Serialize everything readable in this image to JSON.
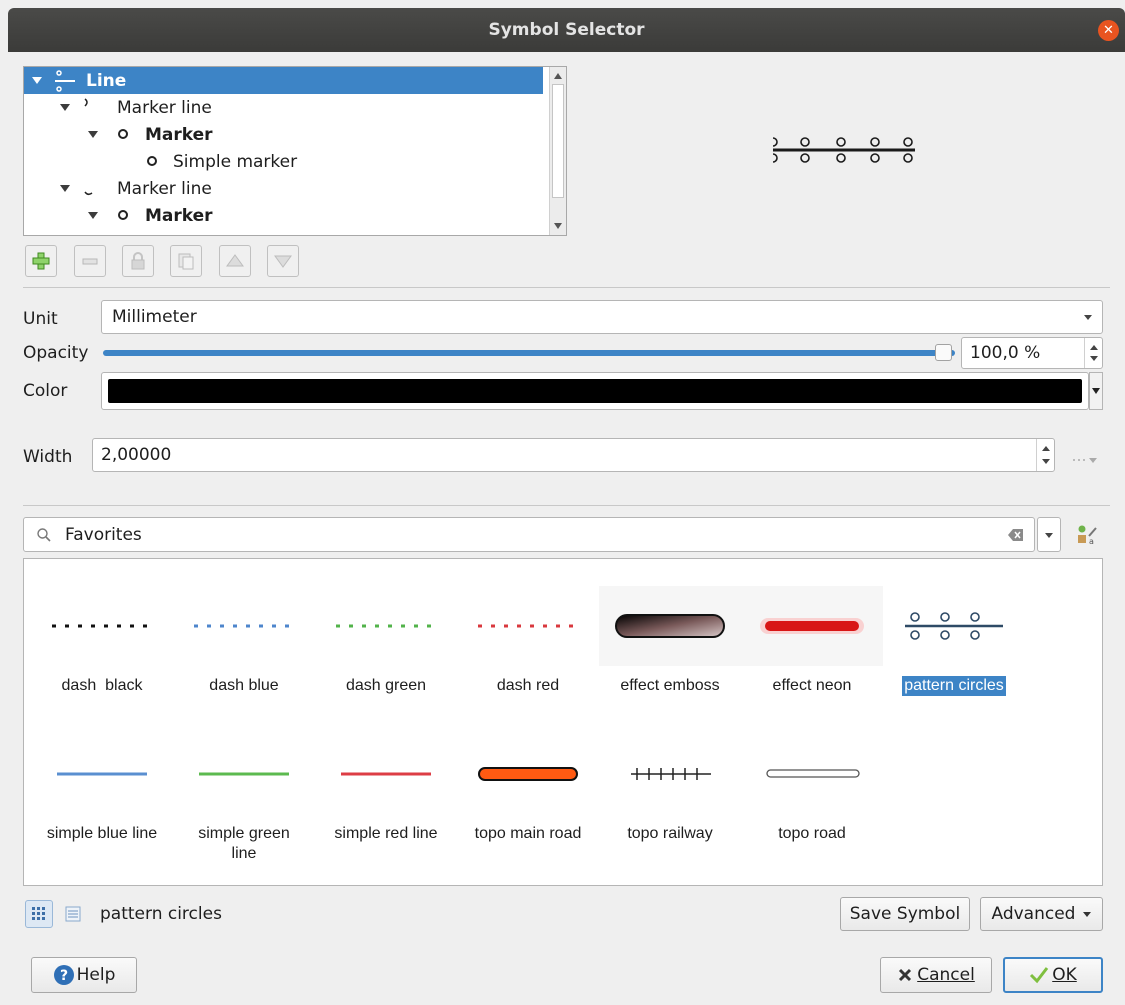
{
  "window": {
    "title": "Symbol Selector",
    "close_glyph": "✕"
  },
  "tree": {
    "rows": [
      {
        "label": "Line",
        "bold": true,
        "selected": true,
        "icon": "line-icon"
      },
      {
        "label": "Marker line",
        "bold": false,
        "icon": "marker-line-icon"
      },
      {
        "label": "Marker",
        "bold": true,
        "icon": "circle-icon"
      },
      {
        "label": "Simple marker",
        "bold": false,
        "icon": "circle-icon"
      },
      {
        "label": "Marker line",
        "bold": false,
        "icon": "marker-line-icon"
      },
      {
        "label": "Marker",
        "bold": true,
        "icon": "circle-icon"
      }
    ]
  },
  "toolbar": {
    "buttons": [
      "add-layer-icon",
      "remove-layer-icon",
      "lock-icon",
      "duplicate-icon",
      "move-up-icon",
      "move-down-icon"
    ]
  },
  "props": {
    "unit_label": "Unit",
    "unit_value": "Millimeter",
    "opacity_label": "Opacity",
    "opacity_value": "100,0 %",
    "opacity_fraction": 1.0,
    "color_label": "Color",
    "color_value": "#000000",
    "width_label": "Width",
    "width_value": "2,00000"
  },
  "search": {
    "value": "Favorites"
  },
  "symbols": [
    {
      "name": "dash  black"
    },
    {
      "name": "dash blue"
    },
    {
      "name": "dash green"
    },
    {
      "name": "dash red"
    },
    {
      "name": "effect emboss"
    },
    {
      "name": "effect neon"
    },
    {
      "name": "pattern circles",
      "selected": true
    },
    {
      "name": "simple blue line"
    },
    {
      "name": "simple green line"
    },
    {
      "name": "simple red line"
    },
    {
      "name": "topo main road"
    },
    {
      "name": "topo railway"
    },
    {
      "name": "topo road"
    }
  ],
  "footer": {
    "selected_name": "pattern circles",
    "save_symbol": "Save Symbol",
    "advanced": "Advanced",
    "help": "Help",
    "cancel": "Cancel",
    "ok": "OK"
  },
  "colors": {
    "accent": "#3d84c6",
    "titlebar": "#3c3b37",
    "close": "#e95420"
  }
}
